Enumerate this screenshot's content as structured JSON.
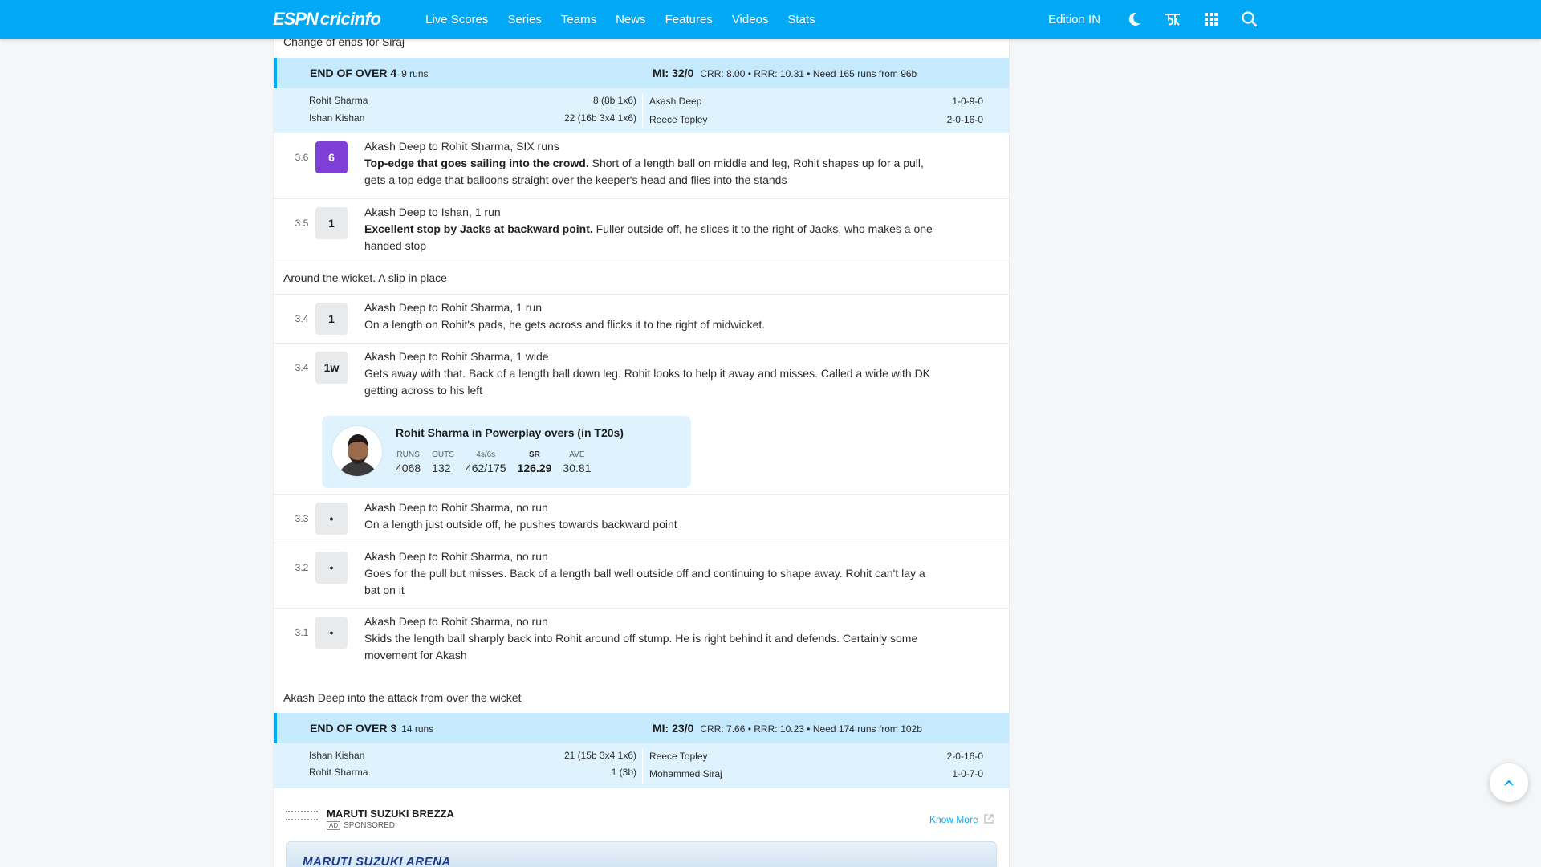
{
  "nav": {
    "logo_espn": "ESPN",
    "logo_ci": "cricinfo",
    "links": [
      "Live Scores",
      "Series",
      "Teams",
      "News",
      "Features",
      "Videos",
      "Stats"
    ],
    "edition": "Edition IN",
    "icons": [
      "moon-icon",
      "language-icon",
      "apps-grid-icon",
      "search-icon"
    ]
  },
  "notes": {
    "siraj": "Change of ends for Siraj",
    "around_wicket": "Around the wicket. A slip in place",
    "akash_attack": "Akash Deep into the attack from over the wicket"
  },
  "over4": {
    "title": "END OF OVER 4",
    "runs": "9 runs",
    "score": "MI: 32/0",
    "rates": "CRR: 8.00 • RRR: 10.31 • Need 165 runs from 96b",
    "batters": [
      {
        "name": "Rohit Sharma",
        "fig": "8 (8b 1x6)"
      },
      {
        "name": "Ishan Kishan",
        "fig": "22 (16b 3x4 1x6)"
      }
    ],
    "bowlers": [
      {
        "name": "Akash Deep",
        "fig": "1-0-9-0"
      },
      {
        "name": "Reece Topley",
        "fig": "2-0-16-0"
      }
    ]
  },
  "balls": [
    {
      "over": "3.6",
      "badge": "6",
      "head": "Akash Deep to Rohit Sharma, SIX runs",
      "bold": "Top-edge that goes sailing into the crowd.",
      "text": " Short of a length ball on middle and leg, Rohit shapes up for a pull, gets a top edge that balloons straight over the keeper's head and flies into the stands"
    },
    {
      "over": "3.5",
      "badge": "1",
      "head": "Akash Deep to Ishan, 1 run",
      "bold": "Excellent stop by Jacks at backward point.",
      "text": " Fuller outside off, he slices it to the right of Jacks, who makes a one-handed stop"
    },
    {
      "over": "3.4",
      "badge": "1",
      "head": "Akash Deep to Rohit Sharma, 1 run",
      "bold": "",
      "text": "On a length on Rohit's pads, he gets across and flicks it to the right of midwicket."
    },
    {
      "over": "3.4",
      "badge": "1w",
      "head": "Akash Deep to Rohit Sharma, 1 wide",
      "bold": "",
      "text": "Gets away with that. Back of a length ball down leg. Rohit looks to help it away and misses. Called a wide with DK getting across to his left"
    },
    {
      "over": "3.3",
      "badge": "•",
      "head": "Akash Deep to Rohit Sharma, no run",
      "bold": "",
      "text": "On a length just outside off, he pushes towards backward point"
    },
    {
      "over": "3.2",
      "badge": "•",
      "head": "Akash Deep to Rohit Sharma, no run",
      "bold": "",
      "text": "Goes for the pull but misses. Back of a length ball well outside off and continuing to shape away. Rohit can't lay a bat on it"
    },
    {
      "over": "3.1",
      "badge": "•",
      "head": "Akash Deep to Rohit Sharma, no run",
      "bold": "",
      "text": "Skids the length ball sharply back into Rohit around off stump. He is right behind it and defends. Certainly some movement for Akash"
    }
  ],
  "statcard": {
    "title": "Rohit Sharma in Powerplay overs (in T20s)",
    "stats": [
      {
        "label": "RUNS",
        "value": "4068"
      },
      {
        "label": "OUTS",
        "value": "132"
      },
      {
        "label": "4s/6s",
        "value": "462/175"
      },
      {
        "label": "SR",
        "value": "126.29"
      },
      {
        "label": "AVE",
        "value": "30.81"
      }
    ]
  },
  "over3": {
    "title": "END OF OVER 3",
    "runs": "14 runs",
    "score": "MI: 23/0",
    "rates": "CRR: 7.66 • RRR: 10.23 • Need 174 runs from 102b",
    "batters": [
      {
        "name": "Ishan Kishan",
        "fig": "21 (15b 3x4 1x6)"
      },
      {
        "name": "Rohit Sharma",
        "fig": "1 (3b)"
      }
    ],
    "bowlers": [
      {
        "name": "Reece Topley",
        "fig": "2-0-16-0"
      },
      {
        "name": "Mohammed Siraj",
        "fig": "1-0-7-0"
      }
    ]
  },
  "ad": {
    "brand": "MARUTI SUZUKI BREZZA",
    "tag": "AD",
    "sponsored": "SPONSORED",
    "more": "Know More",
    "banner": "MARUTI SUZUKI ARENA"
  }
}
